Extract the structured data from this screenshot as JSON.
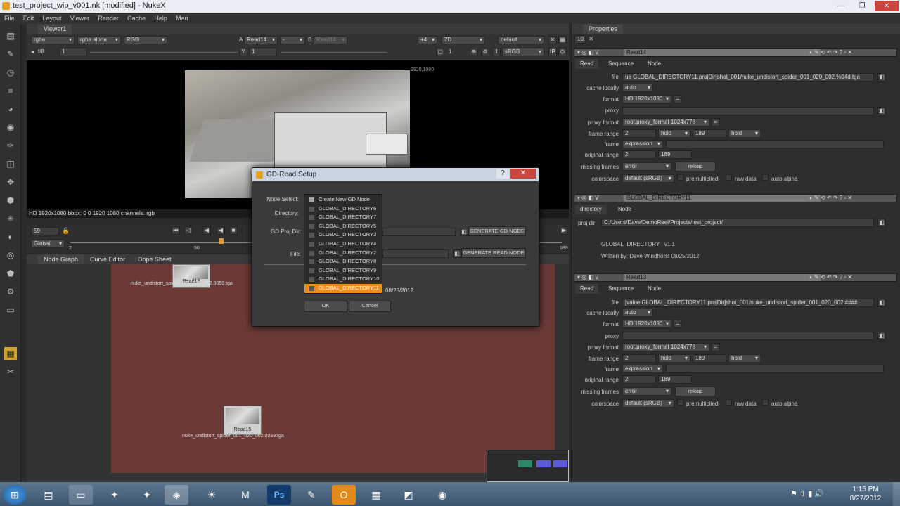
{
  "window": {
    "title": "test_project_wip_v001.nk [modified] - NukeX",
    "minimize": "—",
    "maximize": "❐",
    "close": "✕"
  },
  "menu": [
    "File",
    "Edit",
    "Layout",
    "Viewer",
    "Render",
    "Cache",
    "Help",
    "Mari"
  ],
  "viewer": {
    "tab": "Viewer1",
    "channel_layer": "rgba",
    "channel_alpha": "rgba.alpha",
    "display": "RGB",
    "input_a_label": "A",
    "input_a": "Read14",
    "input_a2": "-",
    "input_b_label": "B",
    "input_b": "Read14",
    "downrez": "+4",
    "mode": "2D",
    "lut_default": "default",
    "fstop": "f/8",
    "gain": "1",
    "gamma_label": "Y",
    "gamma": "1",
    "frame_num": "1",
    "colorspace": "sRGB",
    "ip": "IP",
    "resolution_label": "1920,1080",
    "info": "HD 1920x1080  bbox: 0 0 1920 1080  channels: rgb",
    "frame_current": "59",
    "timeline_mode": "Global",
    "tick_start": "2",
    "tick_mid": "50",
    "tick_end": "189"
  },
  "nodegraph": {
    "tabs": [
      "Node Graph",
      "Curve Editor",
      "Dope Sheet"
    ],
    "nodes": [
      {
        "label": "Read13",
        "caption": "nuke_undistort_spider_001_020_002.0059.tga"
      },
      {
        "label": "Read15",
        "caption": "nuke_undistort_spider_001_020_002.0059.tga"
      }
    ]
  },
  "properties": {
    "tab": "Properties",
    "max_panels": "10",
    "panels": [
      {
        "name": "Read14",
        "tabs": [
          "Read",
          "Sequence",
          "Node"
        ],
        "file": "ue GLOBAL_DIRECTORY11.projDir]shot_001/nuke_undistort_spider_001_020_002.%04d.tga",
        "cache_locally": "auto",
        "format": "HD 1920x1080",
        "proxy": "",
        "proxy_format": "root.proxy_format 1024x778",
        "frame_range_start": "2",
        "frame_range_before": "hold",
        "frame_range_end": "189",
        "frame_range_after": "hold",
        "frame": "expression",
        "original_range_start": "2",
        "original_range_end": "189",
        "missing_frames": "error",
        "reload": "reload",
        "colorspace": "default (sRGB)",
        "premultiplied": "premultiplied",
        "raw_data": "raw data",
        "auto_alpha": "auto alpha"
      },
      {
        "name": "GLOBAL_DIRECTORY11",
        "tabs": [
          "directory",
          "Node"
        ],
        "proj_dir_label": "proj dir",
        "proj_dir": "C:/Users/Dave/DemoReel/Projects/test_project/",
        "version": "GLOBAL_DIRECTORY : v1.1",
        "written_by": "Written by: Dave Windhorst   08/25/2012"
      },
      {
        "name": "Read13",
        "tabs": [
          "Read",
          "Sequence",
          "Node"
        ],
        "file": "[value GLOBAL_DIRECTORY11.projDir]shot_001/nuke_undistort_spider_001_020_002.####",
        "cache_locally": "auto",
        "format": "HD 1920x1080",
        "proxy": "",
        "proxy_format": "root.proxy_format 1024x778",
        "frame_range_start": "2",
        "frame_range_before": "hold",
        "frame_range_end": "189",
        "frame_range_after": "hold",
        "frame": "expression",
        "original_range_start": "2",
        "original_range_end": "189",
        "missing_frames": "error",
        "reload": "reload",
        "colorspace": "default (sRGB)",
        "premultiplied": "premultiplied",
        "raw_data": "raw data",
        "auto_alpha": "auto alpha"
      }
    ],
    "labels": {
      "file": "file",
      "cache_locally": "cache locally",
      "format": "format",
      "proxy": "proxy",
      "proxy_format": "proxy format",
      "frame_range": "frame range",
      "frame": "frame",
      "original_range": "original range",
      "missing_frames": "missing frames",
      "colorspace": "colorspace"
    }
  },
  "dialog": {
    "title": "GD-Read Setup",
    "help": "?",
    "close": "✕",
    "node_select_label": "Node Select:",
    "directory_label": "Directory:",
    "gd_proj_dir_label": "GD Proj Dir:",
    "file_label": "File:",
    "generate_gd_node": "GENERATE GD NODE",
    "generate_read_node": "GENERATE READ NODE",
    "date": "08/25/2012",
    "ok": "OK",
    "cancel": "Cancel",
    "options": [
      "Create New GD Node",
      "GLOBAL_DIRECTORY6",
      "GLOBAL_DIRECTORY7",
      "GLOBAL_DIRECTORY5",
      "GLOBAL_DIRECTORY3",
      "GLOBAL_DIRECTORY4",
      "GLOBAL_DIRECTORY2",
      "GLOBAL_DIRECTORY8",
      "GLOBAL_DIRECTORY9",
      "GLOBAL_DIRECTORY10",
      "GLOBAL_DIRECTORY11"
    ],
    "selected": "GLOBAL_DIRECTORY11"
  },
  "taskbar": {
    "time": "1:15 PM",
    "date": "8/27/2012"
  },
  "colors": {
    "accent": "#f08c1c",
    "backdrop": "#6b3a36"
  }
}
